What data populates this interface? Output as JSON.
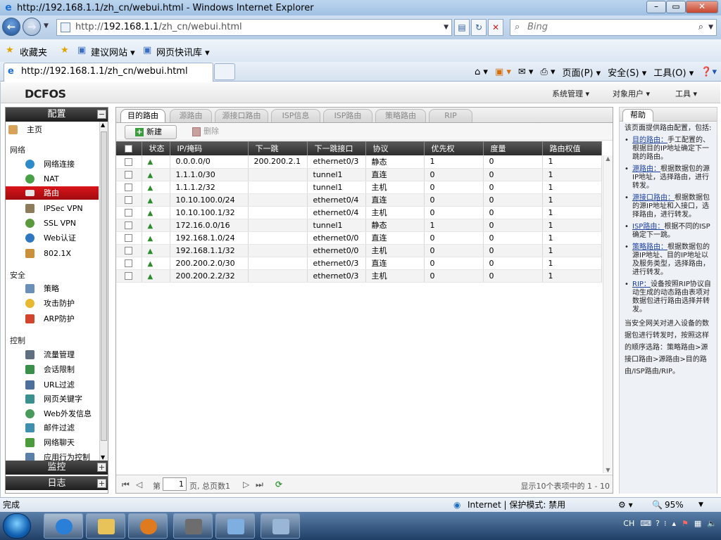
{
  "window": {
    "title": "http://192.168.1.1/zh_cn/webui.html - Windows Internet Explorer"
  },
  "address": {
    "prefix": "http://",
    "host": "192.168.1.1",
    "path": "/zh_cn/webui.html"
  },
  "search": {
    "placeholder": "Bing"
  },
  "favorites": {
    "label": "收藏夹",
    "items": [
      "建议网站 ▾",
      "网页快讯库 ▾"
    ]
  },
  "tab": {
    "title": "http://192.168.1.1/zh_cn/webui.html"
  },
  "commands": {
    "page": "页面(P) ▾",
    "safety": "安全(S) ▾",
    "tools": "工具(O) ▾"
  },
  "app": {
    "logo": "DCFOS",
    "menu": [
      "系统管理 ▾",
      "对象用户 ▾",
      "工具 ▾"
    ]
  },
  "sidebar": {
    "config_header": "配置",
    "monitor_header": "监控",
    "log_header": "日志",
    "home": "主页",
    "sections": {
      "network": "网络",
      "security": "安全",
      "control": "控制"
    },
    "network_items": [
      "网络连接",
      "NAT",
      "路由",
      "IPSec VPN",
      "SSL VPN",
      "Web认证",
      "802.1X"
    ],
    "security_items": [
      "策略",
      "攻击防护",
      "ARP防护"
    ],
    "control_items": [
      "流量管理",
      "会话限制",
      "URL过滤",
      "网页关键字",
      "Web外发信息",
      "邮件过滤",
      "网络聊天",
      "应用行为控制"
    ]
  },
  "main": {
    "tabs": [
      "目的路由",
      "源路由",
      "源接口路由",
      "ISP信息",
      "ISP路由",
      "策略路由",
      "RIP"
    ],
    "new_button": "新建",
    "delete_button": "删除",
    "columns": [
      "状态",
      "IP/掩码",
      "下一跳",
      "下一跳接口",
      "协议",
      "优先权",
      "度量",
      "路由权值"
    ],
    "rows": [
      [
        "0.0.0.0/0",
        "200.200.2.1",
        "ethernet0/3",
        "静态",
        "1",
        "0",
        "1"
      ],
      [
        "1.1.1.0/30",
        "",
        "tunnel1",
        "直连",
        "0",
        "0",
        "1"
      ],
      [
        "1.1.1.2/32",
        "",
        "tunnel1",
        "主机",
        "0",
        "0",
        "1"
      ],
      [
        "10.10.100.0/24",
        "",
        "ethernet0/4",
        "直连",
        "0",
        "0",
        "1"
      ],
      [
        "10.10.100.1/32",
        "",
        "ethernet0/4",
        "主机",
        "0",
        "0",
        "1"
      ],
      [
        "172.16.0.0/16",
        "",
        "tunnel1",
        "静态",
        "1",
        "0",
        "1"
      ],
      [
        "192.168.1.0/24",
        "",
        "ethernet0/0",
        "直连",
        "0",
        "0",
        "1"
      ],
      [
        "192.168.1.1/32",
        "",
        "ethernet0/0",
        "主机",
        "0",
        "0",
        "1"
      ],
      [
        "200.200.2.0/30",
        "",
        "ethernet0/3",
        "直连",
        "0",
        "0",
        "1"
      ],
      [
        "200.200.2.2/32",
        "",
        "ethernet0/3",
        "主机",
        "0",
        "0",
        "1"
      ]
    ],
    "pager": {
      "page_prefix": "第",
      "page_value": "1",
      "page_suffix": "页, 总页数1",
      "summary": "显示10个表项中的 1 - 10"
    }
  },
  "help": {
    "tab": "帮助",
    "intro": "该页面提供路由配置，包括:",
    "items": [
      {
        "link": "目的路由：",
        "text": "手工配置的、根据目的IP地址确定下一跳的路由。"
      },
      {
        "link": "源路由：",
        "text": "根据数据包的源IP地址，选择路由，进行转发。"
      },
      {
        "link": "源接口路由：",
        "text": "根据数据包的源IP地址和入接口，选择路由，进行转发。"
      },
      {
        "link": "ISP路由：",
        "text": "根据不同的ISP确定下一跳。"
      },
      {
        "link": "策略路由：",
        "text": "根据数据包的源IP地址、目的IP地址以及服务类型，选择路由，进行转发。"
      },
      {
        "link": "RIP：",
        "text": "设备按照RIP协议自动生成的动态路由表项对数据包进行路由选择并转发。"
      }
    ],
    "footer": "当安全网关对进入设备的数据包进行转发时，按照这样的顺序选路：策略路由>源接口路由>源路由>目的路由/ISP路由/RIP。"
  },
  "status": {
    "left": "完成",
    "zone": "Internet | 保护模式: 禁用",
    "zoom": "95%"
  },
  "tray": {
    "lang": "CH"
  }
}
